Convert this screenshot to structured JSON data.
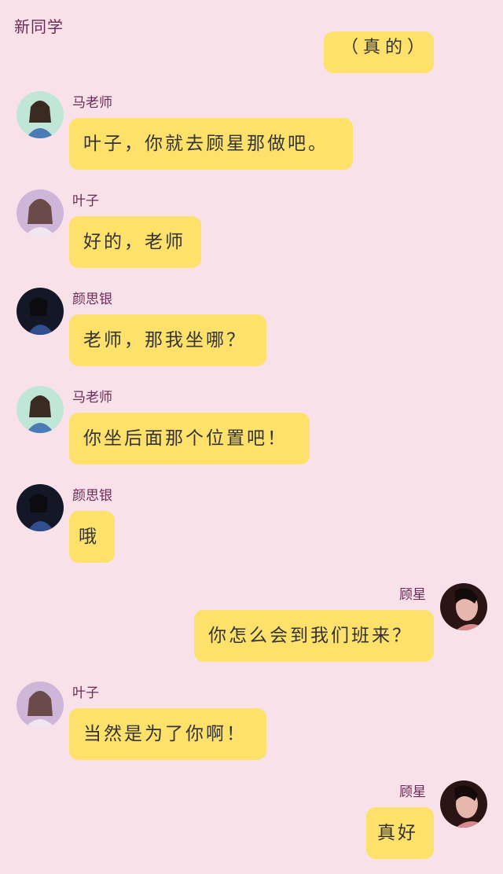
{
  "header": {
    "title": "新同学"
  },
  "partial_bubble": {
    "text": "（真的）"
  },
  "messages": [
    {
      "sender": "马老师",
      "text": "叶子，你就去顾星那做吧。"
    },
    {
      "sender": "叶子",
      "text": "好的，老师"
    },
    {
      "sender": "颜思银",
      "text": "老师，那我坐哪？"
    },
    {
      "sender": "马老师",
      "text": "你坐后面那个位置吧！"
    },
    {
      "sender": "颜思银",
      "text": "哦"
    },
    {
      "sender": "顾星",
      "text": "你怎么会到我们班来？"
    },
    {
      "sender": "叶子",
      "text": "当然是为了你啊！"
    },
    {
      "sender": "顾星",
      "text": "真好"
    }
  ]
}
